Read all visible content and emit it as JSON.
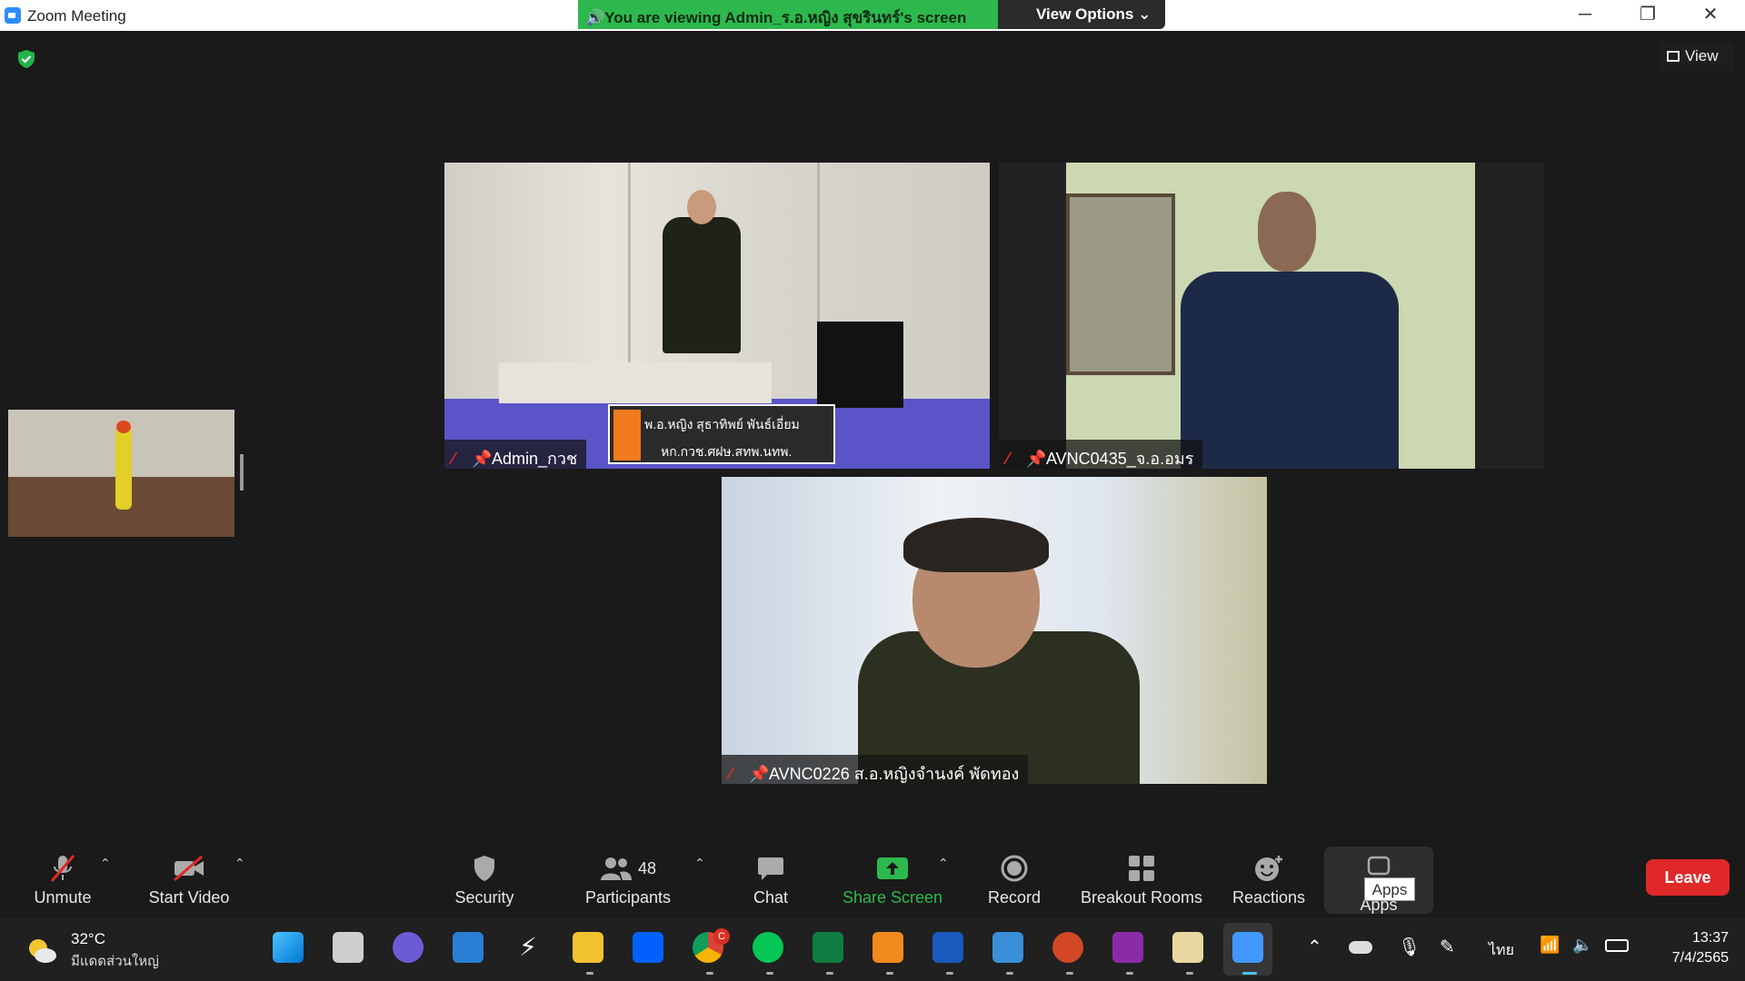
{
  "window": {
    "title": "Zoom Meeting",
    "sharing_banner": "🔊You are viewing Admin_ร.อ.หญิง สุขรินทร์'s screen",
    "view_options": "View Options ⌄",
    "minimize": "─",
    "restore": "❐",
    "close": "✕"
  },
  "view_button": "View",
  "participants_tiles": [
    {
      "name": "Admin_กวช",
      "caption_line1": "พ.อ.หญิง สุธาทิพย์  พันธ์เอี่ยม",
      "caption_line2": "หก.กวช.ศฝษ.สทพ.นทพ."
    },
    {
      "name": "AVNC0435_จ.อ.อมร"
    },
    {
      "name": "AVNC0226 ส.อ.หญิงจำนงค์ พัดทอง"
    }
  ],
  "toolbar": {
    "unmute": "Unmute",
    "start_video": "Start Video",
    "security": "Security",
    "participants": "Participants",
    "participants_count": "48",
    "chat": "Chat",
    "share_screen": "Share Screen",
    "record": "Record",
    "breakout_rooms": "Breakout Rooms",
    "reactions": "Reactions",
    "apps": "Apps",
    "apps_tooltip": "Apps",
    "leave": "Leave"
  },
  "taskbar": {
    "weather_temp": "32°C",
    "weather_desc": "มีแดดส่วนใหญ่",
    "language": "ไทย",
    "time": "13:37",
    "date": "7/4/2565",
    "chrome_badge": "C"
  },
  "colors": {
    "share_green": "#2db84d",
    "leave_red": "#e02828",
    "zoom_blue": "#2d8cff",
    "shield_green": "#23b24b"
  }
}
